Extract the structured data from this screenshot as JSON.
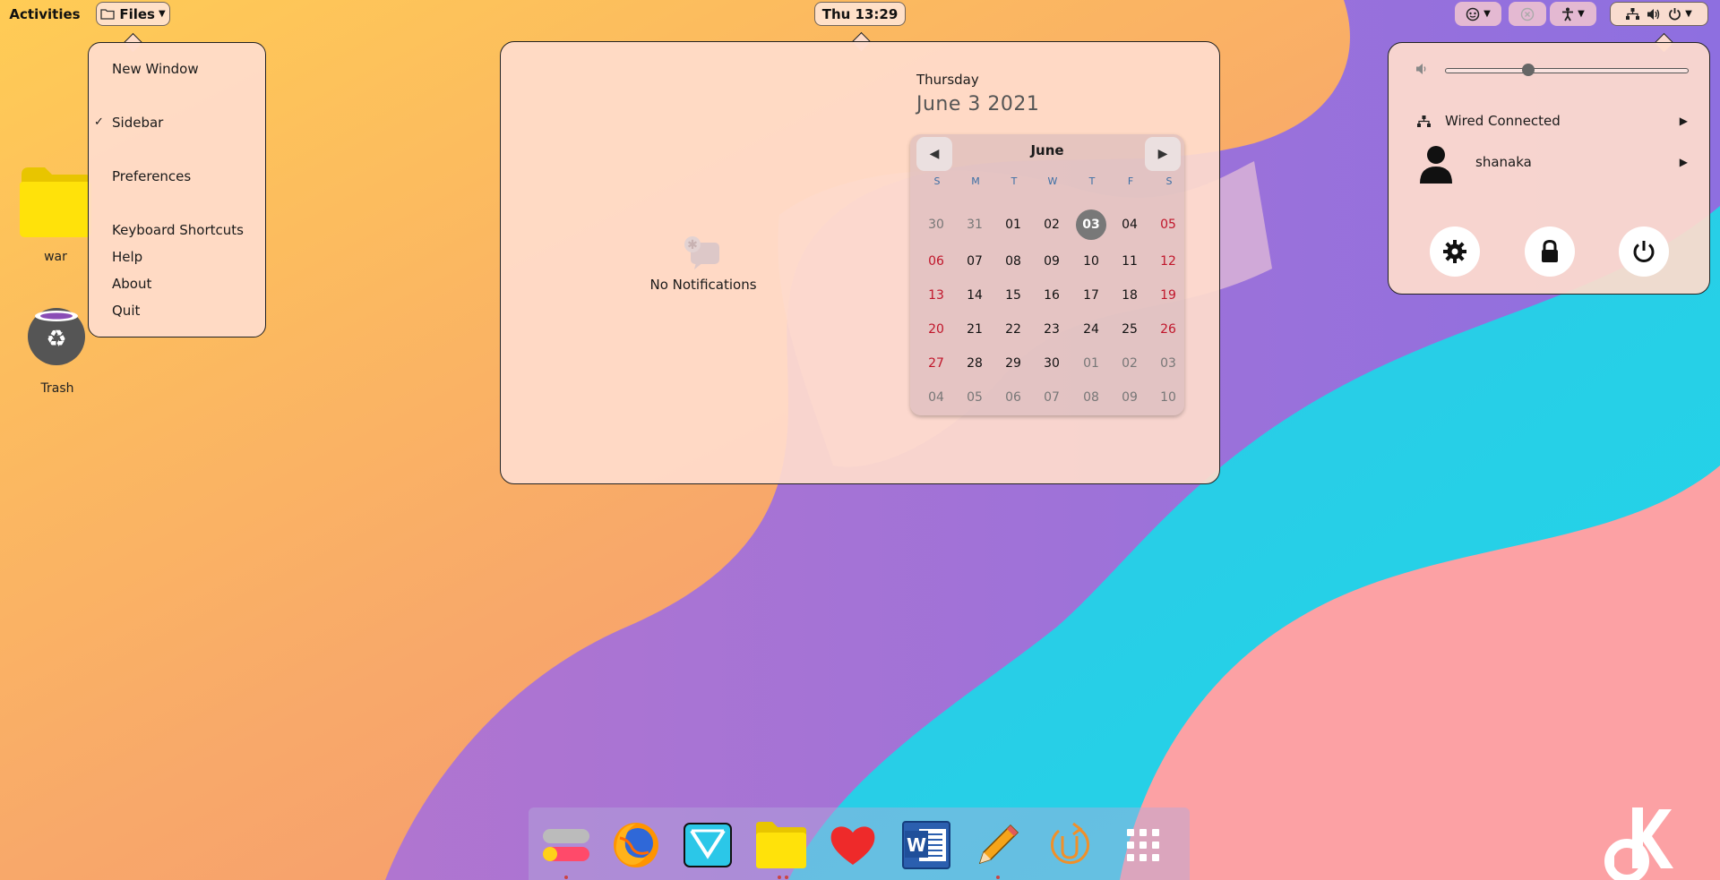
{
  "topbar": {
    "activities": "Activities",
    "app_name": "Files",
    "clock": "Thu 13:29"
  },
  "app_menu": {
    "items": [
      {
        "label": "New Window"
      },
      {
        "label": "Sidebar",
        "checked": true
      },
      {
        "label": "Preferences"
      },
      {
        "label": "Keyboard Shortcuts"
      },
      {
        "label": "Help"
      },
      {
        "label": "About"
      },
      {
        "label": "Quit"
      }
    ]
  },
  "notifications": {
    "empty_label": "No Notifications"
  },
  "calendar": {
    "weekday": "Thursday",
    "date": "June  3 2021",
    "month": "June",
    "dow": [
      "S",
      "M",
      "T",
      "W",
      "T",
      "F",
      "S"
    ],
    "weeks": [
      [
        "30",
        "31",
        "01",
        "02",
        "03",
        "04",
        "05"
      ],
      [
        "06",
        "07",
        "08",
        "09",
        "10",
        "11",
        "12"
      ],
      [
        "13",
        "14",
        "15",
        "16",
        "17",
        "18",
        "19"
      ],
      [
        "20",
        "21",
        "22",
        "23",
        "24",
        "25",
        "26"
      ],
      [
        "27",
        "28",
        "29",
        "30",
        "01",
        "02",
        "03"
      ],
      [
        "04",
        "05",
        "06",
        "07",
        "08",
        "09",
        "10"
      ]
    ],
    "today": "03",
    "volume": 0.34
  },
  "system_menu": {
    "network_label": "Wired Connected",
    "user_label": "shanaka",
    "volume_level": 0.34
  },
  "desktop": {
    "folder_label": "war",
    "trash_label": "Trash"
  },
  "colors": {
    "weekend": "#c0152a",
    "popover": "#ffdccd",
    "today": "#787878"
  }
}
